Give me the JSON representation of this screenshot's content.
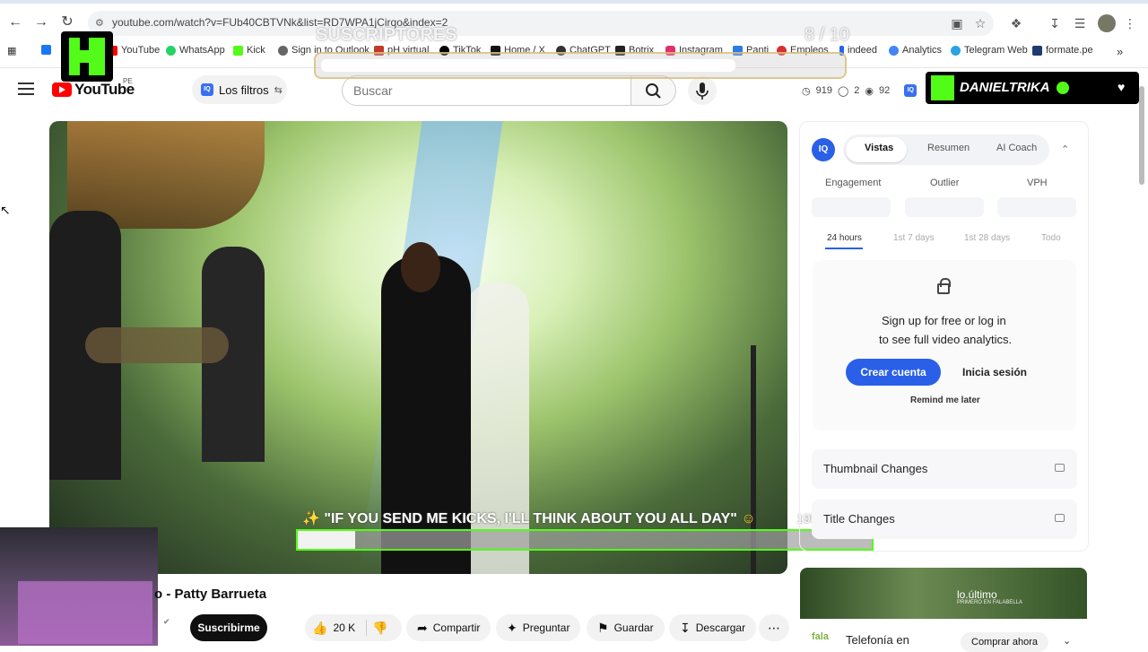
{
  "browser": {
    "url": "youtube.com/watch?v=FUb40CBTVNk&list=RD7WPA1jCirqo&index=2",
    "bookmarks": [
      "YouTube",
      "WhatsApp",
      "Kick",
      "Sign in to Outlook",
      "pH virtual",
      "TikTok",
      "Home / X",
      "ChatGPT",
      "Botrix",
      "Instagram",
      "Panti",
      "Empleos",
      "indeed",
      "Analytics",
      "Telegram Web",
      "formate.pe"
    ],
    "bookmark_colors": [
      "#ff0000",
      "#25d366",
      "#53fc18",
      "#0078d4",
      "#c0392b",
      "#000000",
      "#111111",
      "#333333",
      "#222222",
      "#e1306c",
      "#2c7be5",
      "#d63031",
      "#2164f3",
      "#4285f4",
      "#2aa3e0",
      "#1d3b6e"
    ]
  },
  "overlay": {
    "sub_goal_title": "SUSCRIPTORES",
    "sub_goal_count": "8 / 10",
    "sub_goal_progress": 0.8,
    "channel_name": "DANIELTRIKA",
    "alert_text": "\"IF YOU SEND ME KICKS, I'LL THINK ABOUT YOU ALL DAY\"",
    "alert_count": "195 / 2000",
    "alert_progress": 0.1
  },
  "youtube": {
    "logo_text": "YouTube",
    "region": "PE",
    "filters_label": "Los filtros",
    "search_placeholder": "Buscar",
    "stats": [
      "919",
      "2",
      "92"
    ],
    "video_title": "o - Patty Barrueta",
    "subscribe_label": "Suscribirme",
    "likes": "20 K",
    "share_label": "Compartir",
    "ask_label": "Preguntar",
    "save_label": "Guardar",
    "download_label": "Descargar"
  },
  "vidiq": {
    "logo": "IQ",
    "tabs": [
      "Vistas",
      "Resumen",
      "AI Coach"
    ],
    "metrics": [
      "Engagement",
      "Outlier",
      "VPH"
    ],
    "ranges": [
      "24 hours",
      "1st 7 days",
      "1st 28 days",
      "Todo"
    ],
    "signup_line1": "Sign up for free or log in",
    "signup_line2": "to see full video analytics.",
    "create_label": "Crear cuenta",
    "login_label": "Inicia sesión",
    "remind_label": "Remind me later",
    "locked_rows": [
      "Thumbnail Changes",
      "Title Changes"
    ]
  },
  "ad": {
    "brand": "lo.último",
    "brand_sub": "PRIMERO EN FALABELLA",
    "title": "Telefonía en",
    "cta": "Comprar ahora"
  }
}
